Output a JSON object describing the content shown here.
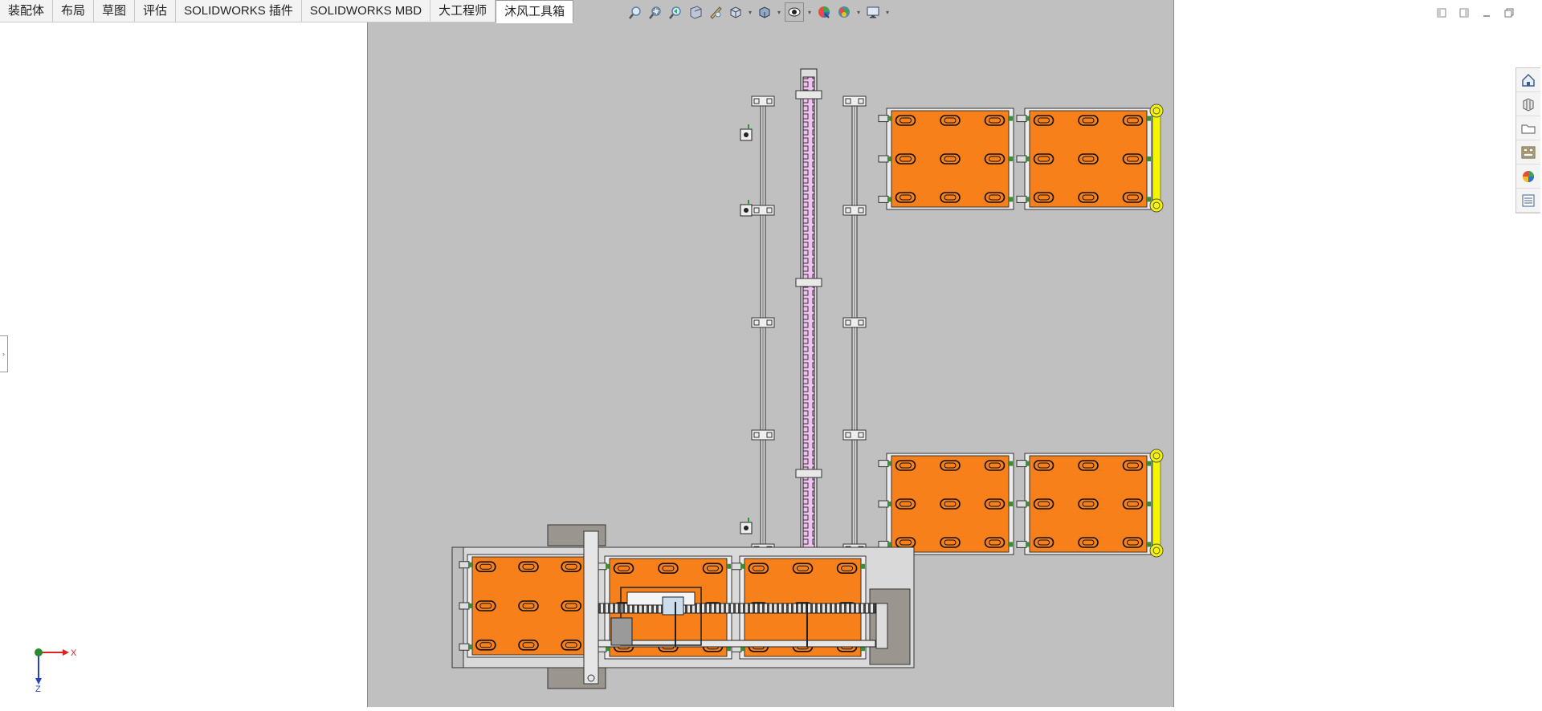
{
  "command_tabs": [
    {
      "label": "装配体",
      "active": false
    },
    {
      "label": "布局",
      "active": false
    },
    {
      "label": "草图",
      "active": false
    },
    {
      "label": "评估",
      "active": false
    },
    {
      "label": "SOLIDWORKS 插件",
      "active": false
    },
    {
      "label": "SOLIDWORKS MBD",
      "active": false
    },
    {
      "label": "大工程师",
      "active": false
    },
    {
      "label": "沐风工具箱",
      "active": true
    }
  ],
  "heads_up_toolbar": [
    "zoom-to-fit-icon",
    "zoom-to-area-icon",
    "previous-view-icon",
    "section-view-icon",
    "dynamic-annotation-icon",
    "view-orientation-icon",
    "display-style-icon",
    "hide-show-items-icon",
    "edit-appearance-icon",
    "apply-scene-icon",
    "view-settings-icon"
  ],
  "window_controls": [
    "tile-left-icon",
    "tile-right-icon",
    "minimize-icon",
    "restore-icon"
  ],
  "task_pane": [
    "solidworks-resources-icon",
    "design-library-icon",
    "file-explorer-icon",
    "view-palette-icon",
    "appearances-icon",
    "custom-properties-icon"
  ],
  "triad": {
    "x_label": "X",
    "z_label": "Z"
  },
  "colors": {
    "viewport_bg": "#c0c0c0",
    "conveyor_orange": "#f7801a",
    "highlight_yellow": "#f5f500",
    "chain_pink": "#f0c2ef",
    "frame_gray": "#9a958e"
  }
}
